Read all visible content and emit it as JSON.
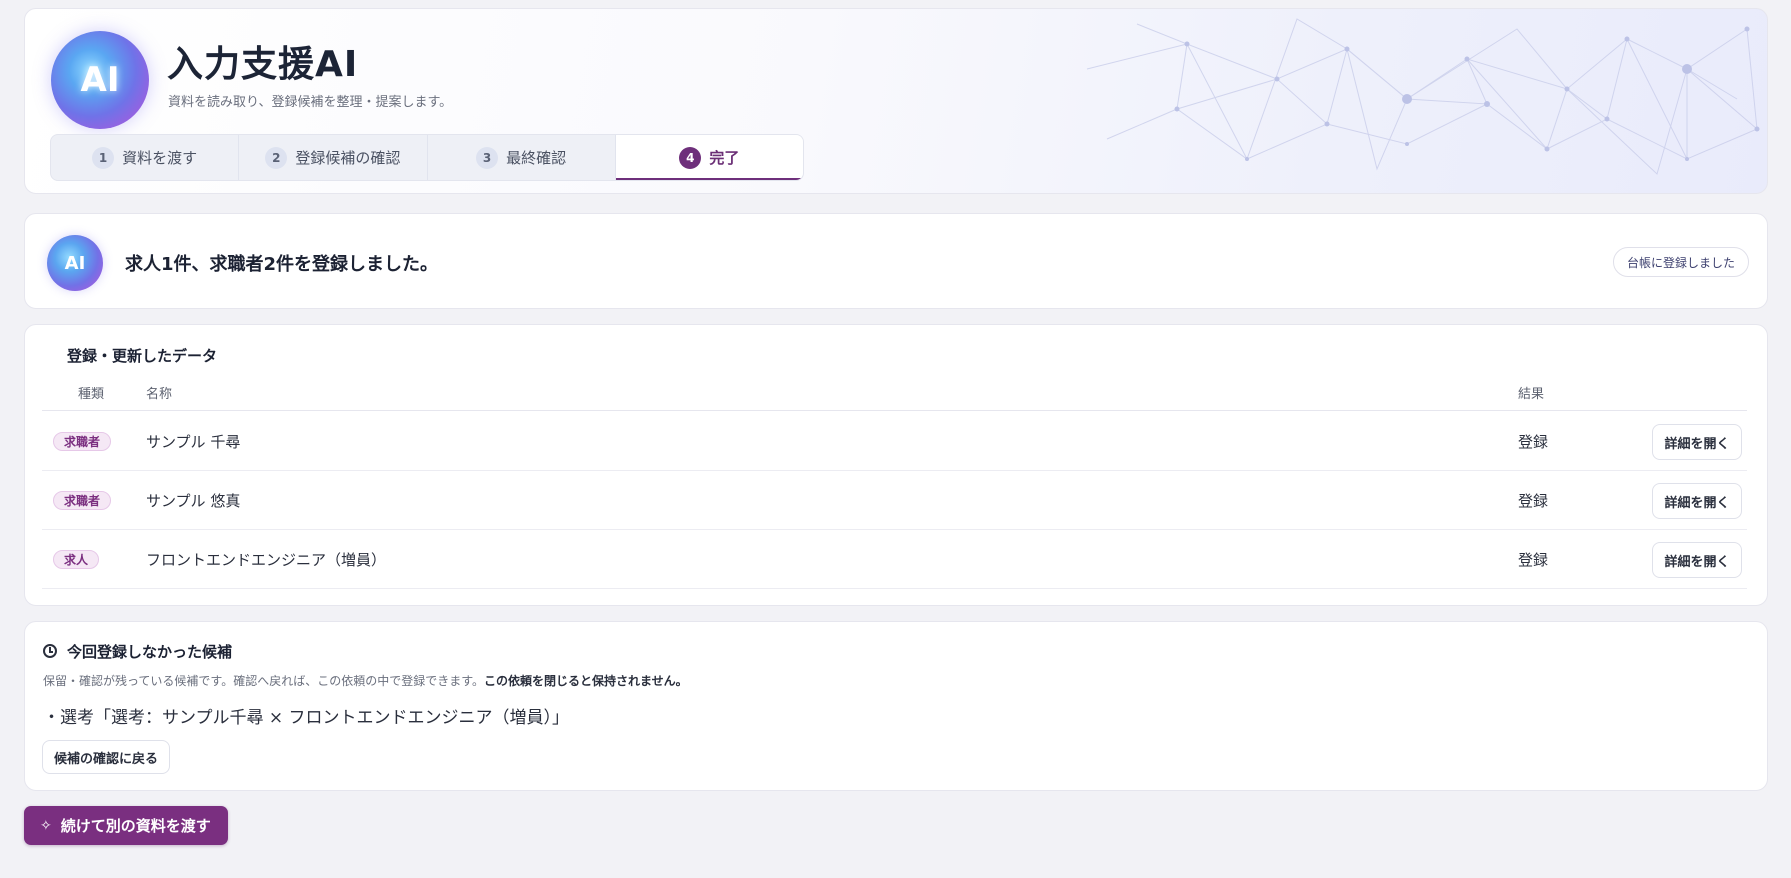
{
  "header": {
    "logo_text": "AI",
    "title": "入力支援AI",
    "subtitle": "資料を読み取り、登録候補を整理・提案します。"
  },
  "steps": [
    {
      "num": "1",
      "label": "資料を渡す"
    },
    {
      "num": "2",
      "label": "登録候補の確認"
    },
    {
      "num": "3",
      "label": "最終確認"
    },
    {
      "num": "4",
      "label": "完了"
    }
  ],
  "banner": {
    "logo_text": "AI",
    "message": "求人1件、求職者2件を登録しました。",
    "status_badge": "台帳に登録しました"
  },
  "data_table": {
    "title": "登録・更新したデータ",
    "columns": {
      "type": "種類",
      "name": "名称",
      "result": "結果"
    },
    "rows": [
      {
        "type": "求職者",
        "name": "サンプル 千尋",
        "result": "登録",
        "action": "詳細を開く"
      },
      {
        "type": "求職者",
        "name": "サンプル 悠真",
        "result": "登録",
        "action": "詳細を開く"
      },
      {
        "type": "求人",
        "name": "フロントエンドエンジニア（増員）",
        "result": "登録",
        "action": "詳細を開く"
      }
    ]
  },
  "pending": {
    "title": "今回登録しなかった候補",
    "description": "保留・確認が残っている候補です。確認へ戻れば、この依頼の中で登録できます。",
    "description_bold": "この依頼を閉じると保持されません。",
    "item": "・選考「選考：サンプル千尋 × フロントエンドエンジニア（増員）」",
    "back_button": "候補の確認に戻る"
  },
  "primary_action": {
    "label": "続けて別の資料を渡す",
    "icon": "sparkle-icon"
  },
  "colors": {
    "accent": "#7a2f80",
    "badge_bg": "#f5e8f5",
    "page_bg": "#f2f2f6"
  }
}
